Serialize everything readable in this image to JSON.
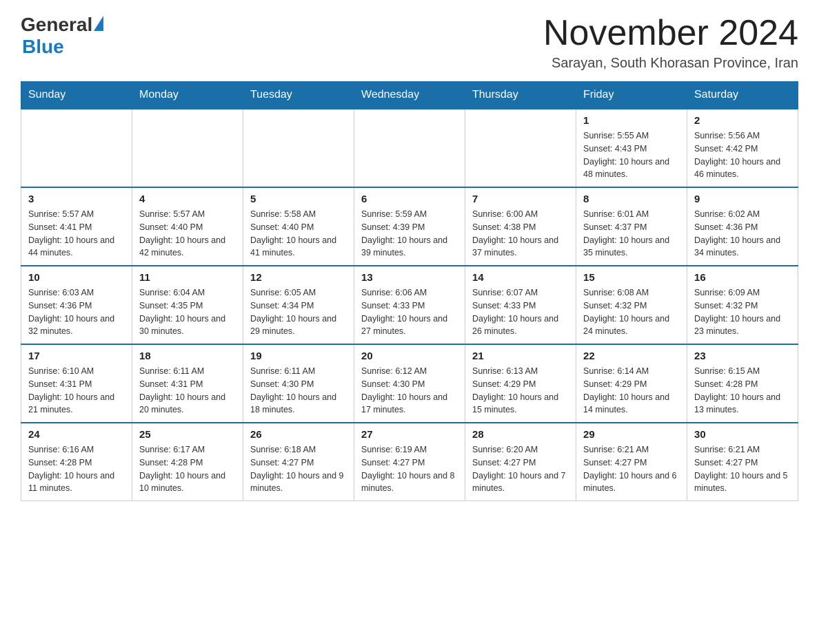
{
  "logo": {
    "general": "General",
    "blue": "Blue"
  },
  "title": "November 2024",
  "location": "Sarayan, South Khorasan Province, Iran",
  "days_of_week": [
    "Sunday",
    "Monday",
    "Tuesday",
    "Wednesday",
    "Thursday",
    "Friday",
    "Saturday"
  ],
  "weeks": [
    [
      {
        "day": "",
        "info": ""
      },
      {
        "day": "",
        "info": ""
      },
      {
        "day": "",
        "info": ""
      },
      {
        "day": "",
        "info": ""
      },
      {
        "day": "",
        "info": ""
      },
      {
        "day": "1",
        "info": "Sunrise: 5:55 AM\nSunset: 4:43 PM\nDaylight: 10 hours and 48 minutes."
      },
      {
        "day": "2",
        "info": "Sunrise: 5:56 AM\nSunset: 4:42 PM\nDaylight: 10 hours and 46 minutes."
      }
    ],
    [
      {
        "day": "3",
        "info": "Sunrise: 5:57 AM\nSunset: 4:41 PM\nDaylight: 10 hours and 44 minutes."
      },
      {
        "day": "4",
        "info": "Sunrise: 5:57 AM\nSunset: 4:40 PM\nDaylight: 10 hours and 42 minutes."
      },
      {
        "day": "5",
        "info": "Sunrise: 5:58 AM\nSunset: 4:40 PM\nDaylight: 10 hours and 41 minutes."
      },
      {
        "day": "6",
        "info": "Sunrise: 5:59 AM\nSunset: 4:39 PM\nDaylight: 10 hours and 39 minutes."
      },
      {
        "day": "7",
        "info": "Sunrise: 6:00 AM\nSunset: 4:38 PM\nDaylight: 10 hours and 37 minutes."
      },
      {
        "day": "8",
        "info": "Sunrise: 6:01 AM\nSunset: 4:37 PM\nDaylight: 10 hours and 35 minutes."
      },
      {
        "day": "9",
        "info": "Sunrise: 6:02 AM\nSunset: 4:36 PM\nDaylight: 10 hours and 34 minutes."
      }
    ],
    [
      {
        "day": "10",
        "info": "Sunrise: 6:03 AM\nSunset: 4:36 PM\nDaylight: 10 hours and 32 minutes."
      },
      {
        "day": "11",
        "info": "Sunrise: 6:04 AM\nSunset: 4:35 PM\nDaylight: 10 hours and 30 minutes."
      },
      {
        "day": "12",
        "info": "Sunrise: 6:05 AM\nSunset: 4:34 PM\nDaylight: 10 hours and 29 minutes."
      },
      {
        "day": "13",
        "info": "Sunrise: 6:06 AM\nSunset: 4:33 PM\nDaylight: 10 hours and 27 minutes."
      },
      {
        "day": "14",
        "info": "Sunrise: 6:07 AM\nSunset: 4:33 PM\nDaylight: 10 hours and 26 minutes."
      },
      {
        "day": "15",
        "info": "Sunrise: 6:08 AM\nSunset: 4:32 PM\nDaylight: 10 hours and 24 minutes."
      },
      {
        "day": "16",
        "info": "Sunrise: 6:09 AM\nSunset: 4:32 PM\nDaylight: 10 hours and 23 minutes."
      }
    ],
    [
      {
        "day": "17",
        "info": "Sunrise: 6:10 AM\nSunset: 4:31 PM\nDaylight: 10 hours and 21 minutes."
      },
      {
        "day": "18",
        "info": "Sunrise: 6:11 AM\nSunset: 4:31 PM\nDaylight: 10 hours and 20 minutes."
      },
      {
        "day": "19",
        "info": "Sunrise: 6:11 AM\nSunset: 4:30 PM\nDaylight: 10 hours and 18 minutes."
      },
      {
        "day": "20",
        "info": "Sunrise: 6:12 AM\nSunset: 4:30 PM\nDaylight: 10 hours and 17 minutes."
      },
      {
        "day": "21",
        "info": "Sunrise: 6:13 AM\nSunset: 4:29 PM\nDaylight: 10 hours and 15 minutes."
      },
      {
        "day": "22",
        "info": "Sunrise: 6:14 AM\nSunset: 4:29 PM\nDaylight: 10 hours and 14 minutes."
      },
      {
        "day": "23",
        "info": "Sunrise: 6:15 AM\nSunset: 4:28 PM\nDaylight: 10 hours and 13 minutes."
      }
    ],
    [
      {
        "day": "24",
        "info": "Sunrise: 6:16 AM\nSunset: 4:28 PM\nDaylight: 10 hours and 11 minutes."
      },
      {
        "day": "25",
        "info": "Sunrise: 6:17 AM\nSunset: 4:28 PM\nDaylight: 10 hours and 10 minutes."
      },
      {
        "day": "26",
        "info": "Sunrise: 6:18 AM\nSunset: 4:27 PM\nDaylight: 10 hours and 9 minutes."
      },
      {
        "day": "27",
        "info": "Sunrise: 6:19 AM\nSunset: 4:27 PM\nDaylight: 10 hours and 8 minutes."
      },
      {
        "day": "28",
        "info": "Sunrise: 6:20 AM\nSunset: 4:27 PM\nDaylight: 10 hours and 7 minutes."
      },
      {
        "day": "29",
        "info": "Sunrise: 6:21 AM\nSunset: 4:27 PM\nDaylight: 10 hours and 6 minutes."
      },
      {
        "day": "30",
        "info": "Sunrise: 6:21 AM\nSunset: 4:27 PM\nDaylight: 10 hours and 5 minutes."
      }
    ]
  ]
}
